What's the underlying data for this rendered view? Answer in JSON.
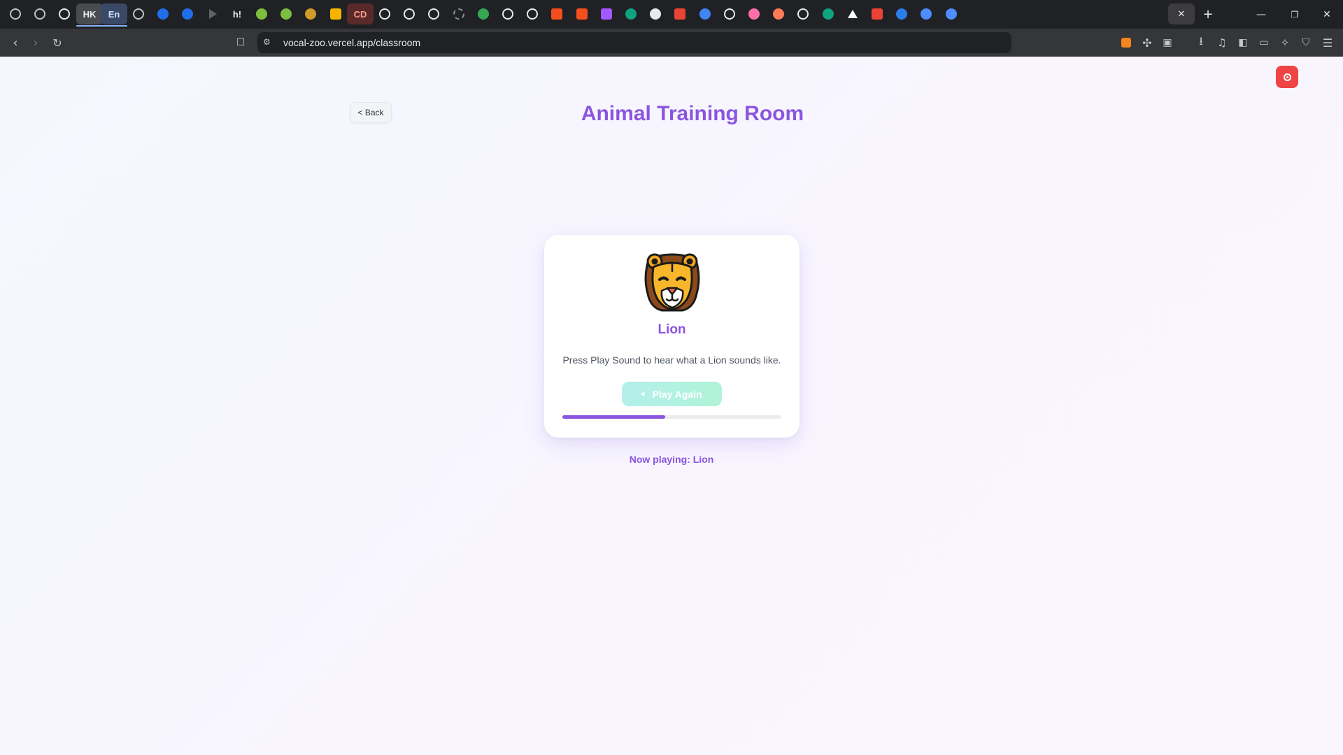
{
  "browser": {
    "tabs": [
      {
        "icon": "settings-icon",
        "color": "#bfc3c8"
      },
      {
        "icon": "ring-icon",
        "color": "#bfc3c8"
      },
      {
        "icon": "github-icon",
        "color": "#e8eaed"
      },
      {
        "icon": "text",
        "label": "HK"
      },
      {
        "icon": "text",
        "label": "En"
      },
      {
        "icon": "ring-icon",
        "color": "#bfc3c8"
      },
      {
        "icon": "app-icon",
        "color": "#1f6feb"
      },
      {
        "icon": "app-icon",
        "color": "#1f6feb"
      },
      {
        "icon": "play-icon",
        "color": "#5f6368"
      },
      {
        "icon": "text",
        "label": "h!"
      },
      {
        "icon": "globe-icon",
        "color": "#7cbf3f"
      },
      {
        "icon": "globe-icon",
        "color": "#7cbf3f"
      },
      {
        "icon": "moon-icon",
        "color": "#d39b2a"
      },
      {
        "icon": "note-icon",
        "color": "#f4b400"
      },
      {
        "icon": "text",
        "label": "CD"
      },
      {
        "icon": "github-icon",
        "color": "#e8eaed"
      },
      {
        "icon": "github-icon",
        "color": "#e8eaed"
      },
      {
        "icon": "github-icon",
        "color": "#e8eaed"
      },
      {
        "icon": "loading-icon",
        "color": "#8a8d92"
      },
      {
        "icon": "app-icon",
        "color": "#34a853"
      },
      {
        "icon": "github-icon",
        "color": "#e8eaed"
      },
      {
        "icon": "github-icon",
        "color": "#e8eaed"
      },
      {
        "icon": "figma-icon",
        "color": "#f24e1e"
      },
      {
        "icon": "figma-icon",
        "color": "#f24e1e"
      },
      {
        "icon": "figma-icon",
        "color": "#a259ff"
      },
      {
        "icon": "app-icon",
        "color": "#10a37f"
      },
      {
        "icon": "app-icon",
        "color": "#e8eaed"
      },
      {
        "icon": "gmail-icon",
        "color": "#ea4335"
      },
      {
        "icon": "app-icon",
        "color": "#4285f4"
      },
      {
        "icon": "github-icon",
        "color": "#e8eaed"
      },
      {
        "icon": "flower-icon",
        "color": "#ff6fa8"
      },
      {
        "icon": "app-icon",
        "color": "#ff7a59"
      },
      {
        "icon": "github-icon",
        "color": "#e8eaed"
      },
      {
        "icon": "app-icon",
        "color": "#10a37f"
      },
      {
        "icon": "triangle-icon",
        "color": "#ffffff"
      },
      {
        "icon": "gmail-icon",
        "color": "#ea4335"
      },
      {
        "icon": "app-icon",
        "color": "#2b7de9"
      },
      {
        "icon": "app-icon",
        "color": "#4f8cff"
      },
      {
        "icon": "app-icon",
        "color": "#4f8cff"
      }
    ],
    "active_tab_index": 38,
    "close_label": "✕",
    "new_tab_label": "+",
    "url": "vocal-zoo.vercel.app/classroom"
  },
  "page": {
    "back_label": "< Back",
    "title": "Animal Training Room",
    "animal": {
      "emoji_icon": "lion-icon",
      "name": "Lion",
      "instruction": "Press Play Sound to hear what a Lion sounds like.",
      "play_label": "Play Again",
      "progress": 0.47
    },
    "now_playing": "Now playing: Lion",
    "colors": {
      "accent": "#8b55e0",
      "record_button": "#ee4444"
    }
  }
}
